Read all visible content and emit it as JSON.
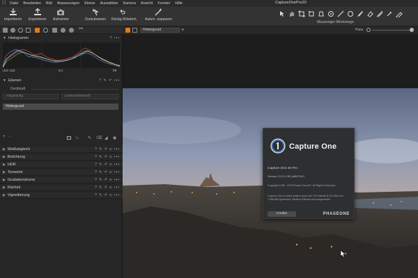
{
  "menubar": {
    "items": [
      "Datei",
      "Bearbeiten",
      "Bild",
      "Anpassungen",
      "Ebene",
      "Auswählen",
      "Kamera",
      "Ansicht",
      "Fenster",
      "Hilfe"
    ],
    "app_title": "CaptureOnePro20"
  },
  "toolbar": {
    "import": "Importieren",
    "export": "Exportieren",
    "capture": "Aufnahme",
    "reset": "Zurücksetzen",
    "undo_redo": "Rückg./Wiederh.",
    "auto_adjust": "Autom. anpassen",
    "cursor_tools": "Mauszeiger-Werkzeuge"
  },
  "viewer": {
    "variant": "Hintergrund",
    "fit": "Pass."
  },
  "histogram": {
    "title": "Histogramm",
    "iso": "ISO 100",
    "shutter": "8 s",
    "aperture": "f/9"
  },
  "layers": {
    "title": "Ebenen",
    "opacity": "Deckkraft",
    "adjust_btn": "Anpassung",
    "luma_btn": "Luminanzbereich",
    "background_layer": "Hintergrund"
  },
  "adjustments": [
    "Weißabgleich",
    "Belichtung",
    "HDR",
    "Tonwerte",
    "Gradationskurve",
    "Klarheit",
    "Vignettierung"
  ],
  "about": {
    "name": "Capture One",
    "product": "Capture One 20 Pro",
    "version": "Version 13.0.0.155 (a8007e2)",
    "copyright": "Copyright 1999 - 2019 Phase One A/S. All Rights Reserved.",
    "license": "Capture One is under andere durch die US Patente 6,707,500 und 7,555,660 geschützt. Weitere Patente sind angemeldet.",
    "credits": "Credits",
    "brand": "PHASEONE"
  },
  "colors": {
    "accent": "#e2791f",
    "panel": "#262626",
    "dialog": "#2e2f31"
  }
}
